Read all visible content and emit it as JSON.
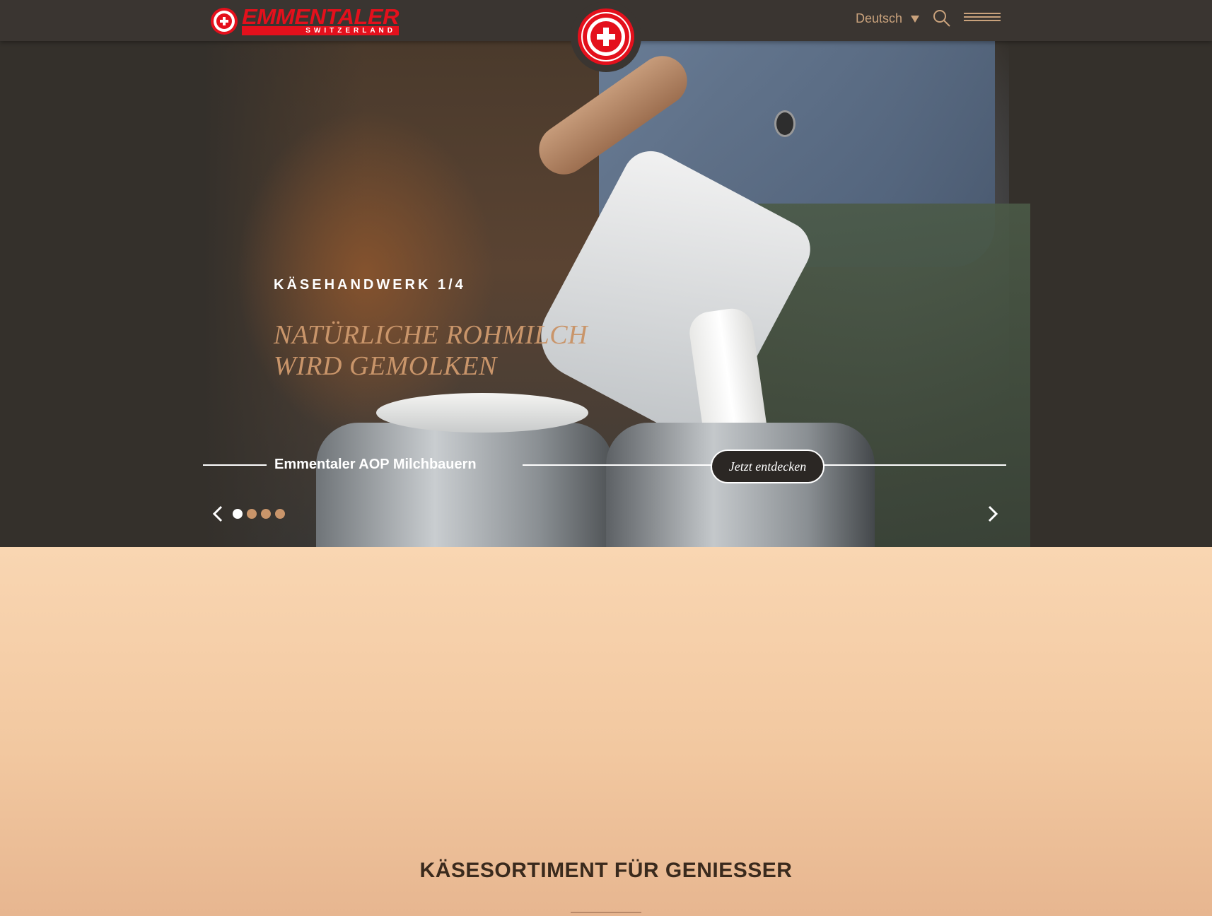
{
  "header": {
    "logo": {
      "word": "EMMENTALER",
      "sub": "SWITZERLAND"
    },
    "language": "Deutsch",
    "icons": {
      "search": "search-icon",
      "menu": "hamburger-menu-icon",
      "caret": "caret-down-icon"
    }
  },
  "hero": {
    "kicker": "KÄSEHANDWERK 1/4",
    "title_line1": "NATÜRLICHE ROHMILCH",
    "title_line2": "WIRD GEMOLKEN",
    "subtitle": "Emmentaler AOP Milchbauern",
    "cta_label": "Jetzt entdecken",
    "slides": {
      "count": 4,
      "active": 1
    }
  },
  "section": {
    "title": "KÄSESORTIMENT FÜR GENIESSER"
  },
  "colors": {
    "brand_red": "#e4101c",
    "header_bg": "#3a3531",
    "accent_gold": "#c9956a",
    "page_peach": "#f2cba6"
  }
}
